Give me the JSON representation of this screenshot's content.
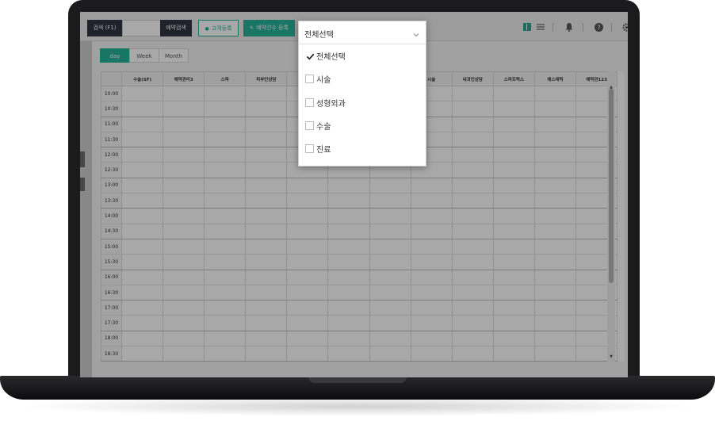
{
  "toolbar": {
    "search_button": "검색 (F1)",
    "search_value": "",
    "reservation_search_button": "예약검색",
    "customer_register_button": "고객등록",
    "reservation_count_button": "예약건수 등록"
  },
  "view_tabs": [
    "day",
    "Week",
    "Month"
  ],
  "active_view": "day",
  "schedule": {
    "columns": [
      "",
      "수술(SF)",
      "예약관리3",
      "스파",
      "피부인상담",
      "",
      "",
      "",
      "시술",
      "내과인상담",
      "스파트럭스",
      "에스테틱",
      "예약관123"
    ],
    "times": [
      "10:00",
      "10:30",
      "11:00",
      "11:30",
      "12:00",
      "12:30",
      "13:00",
      "13:30",
      "14:00",
      "14:30",
      "15:00",
      "15:30",
      "16:00",
      "16:30",
      "17:00",
      "17:30",
      "18:00",
      "18:30"
    ]
  },
  "dropdown": {
    "selected": "전체선택",
    "options": [
      {
        "label": "전체선택",
        "checked": true
      },
      {
        "label": "시술",
        "checked": false
      },
      {
        "label": "성형외과",
        "checked": false
      },
      {
        "label": "수술",
        "checked": false
      },
      {
        "label": "진료",
        "checked": false
      }
    ]
  },
  "icons": {
    "customer_register": "user-icon",
    "reservation_count": "pencil-icon",
    "view_calendar": "calendar-grid-icon",
    "view_list": "list-icon",
    "notifications": "bell-icon",
    "help": "help-icon",
    "settings": "gear-icon"
  },
  "colors": {
    "accent": "#27b39a",
    "dark_button": "#2f3542"
  }
}
